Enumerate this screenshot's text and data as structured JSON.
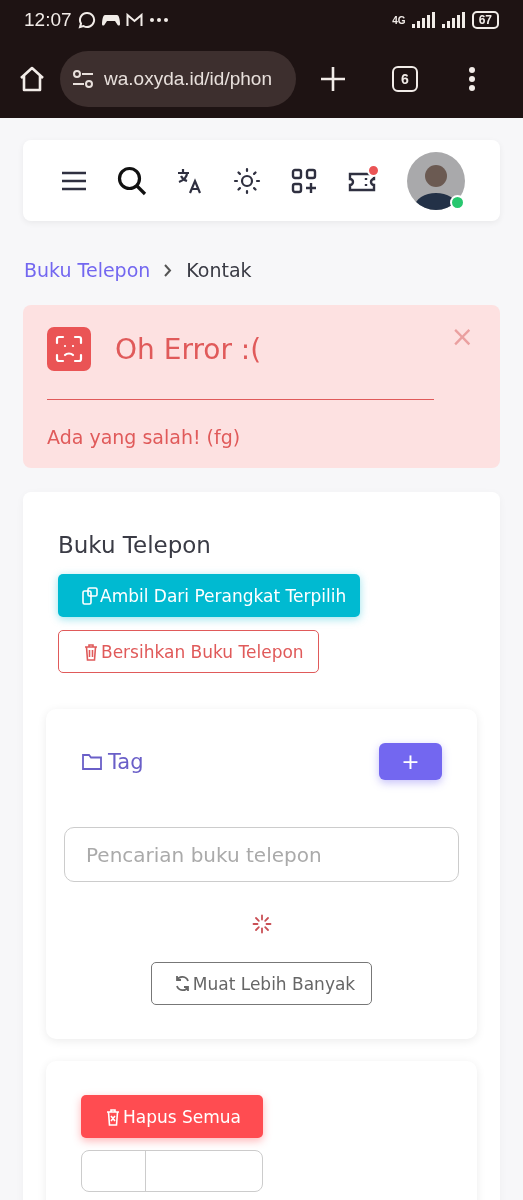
{
  "status_bar": {
    "time": "12:07",
    "network": "4G",
    "battery": "67"
  },
  "browser": {
    "url": "wa.oxyda.id/id/phon",
    "tab_count": "6"
  },
  "navbar": {
    "notification": true,
    "online": true
  },
  "breadcrumb": [
    {
      "label": "Buku Telepon",
      "kind": "link"
    },
    {
      "label": "Kontak",
      "kind": "current"
    }
  ],
  "alert": {
    "title": "Oh Error :(",
    "message": "Ada yang salah! (fg)",
    "close": "×"
  },
  "phonebook": {
    "title": "Buku Telepon",
    "buttons": [
      {
        "label": "Ambil Dari Perangkat Terpilih",
        "kind": "fetch"
      },
      {
        "label": "Bersihkan Buku Telepon",
        "kind": "clear"
      }
    ]
  },
  "tags": {
    "title": "Tag",
    "add": "+",
    "search": {
      "placeholder": "Pencarian buku telepon"
    },
    "loading": true,
    "load_more": "Muat Lebih Banyak"
  },
  "contacts": {
    "delete_all": "Hapus Semua"
  }
}
